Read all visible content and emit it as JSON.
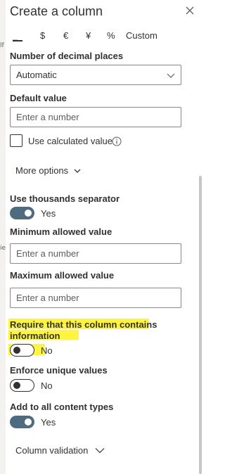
{
  "panel": {
    "title": "Create a column",
    "close_icon": "close-icon"
  },
  "left_fragments": [
    "lf",
    "ie"
  ],
  "currency_formats": [
    {
      "symbol": "_",
      "selected": true
    },
    {
      "symbol": "$"
    },
    {
      "symbol": "€"
    },
    {
      "symbol": "¥"
    },
    {
      "symbol": "%"
    },
    {
      "symbol": "Custom"
    }
  ],
  "decimal_places": {
    "label": "Number of decimal places",
    "value": "Automatic"
  },
  "default_value": {
    "label": "Default value",
    "placeholder": "Enter a number"
  },
  "calculated": {
    "label": "Use calculated value",
    "checked": false
  },
  "more_options": "More options",
  "thousands": {
    "label": "Use thousands separator",
    "state": "Yes",
    "on": true
  },
  "minimum": {
    "label": "Minimum allowed value",
    "placeholder": "Enter a number"
  },
  "maximum": {
    "label": "Maximum allowed value",
    "placeholder": "Enter a number"
  },
  "require": {
    "label_line1": "Require that this column contains",
    "label_line2": "information",
    "state": "No",
    "on": false
  },
  "unique": {
    "label": "Enforce unique values",
    "state": "No",
    "on": false
  },
  "content_types": {
    "label": "Add to all content types",
    "state": "Yes",
    "on": true
  },
  "column_validation": "Column validation",
  "colors": {
    "toggle_on": "#4f6b7f",
    "highlight": "#fff200",
    "text": "#323130",
    "border": "#8a8886"
  }
}
